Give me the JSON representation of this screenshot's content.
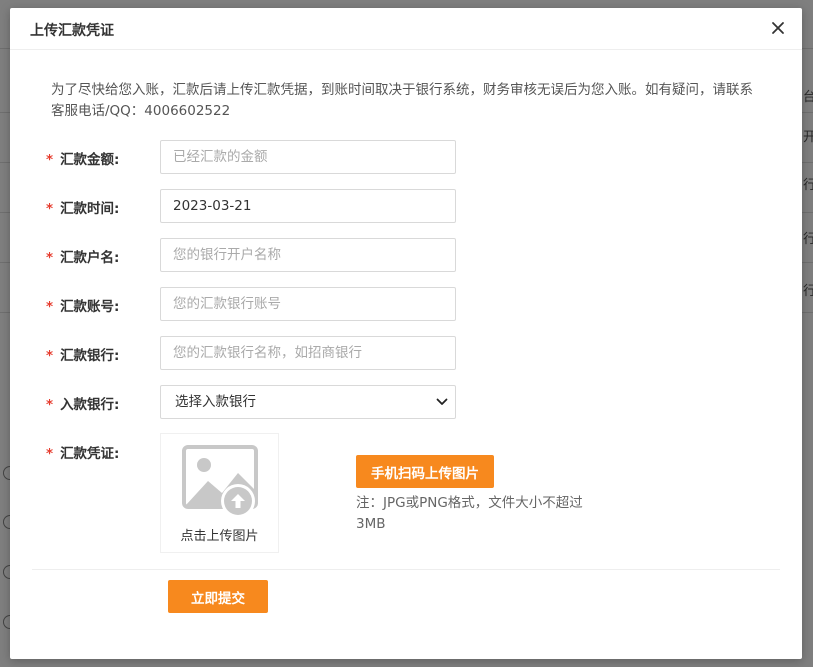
{
  "modal": {
    "title": "上传汇款凭证",
    "notice": "为了尽快给您入账，汇款后请上传汇款凭据，到账时间取决于银行系统，财务审核无误后为您入账。如有疑问，请联系客服电话/QQ：4006602522"
  },
  "form": {
    "required_mark": "*",
    "amount": {
      "label": "汇款金额:",
      "value": "",
      "placeholder": "已经汇款的金额"
    },
    "date": {
      "label": "汇款时间:",
      "value": "2023-03-21",
      "placeholder": ""
    },
    "account_name": {
      "label": "汇款户名:",
      "value": "",
      "placeholder": "您的银行开户名称"
    },
    "account_number": {
      "label": "汇款账号:",
      "value": "",
      "placeholder": "您的汇款银行账号"
    },
    "bank": {
      "label": "汇款银行:",
      "value": "",
      "placeholder": "您的汇款银行名称，如招商银行"
    },
    "receiving_bank": {
      "label": "入款银行:",
      "selected": "选择入款银行"
    },
    "voucher": {
      "label": "汇款凭证:",
      "upload_text": "点击上传图片",
      "upload_icon": "image-upload-icon",
      "scan_button": "手机扫码上传图片",
      "hint": "注：JPG或PNG格式，文件大小不超过3MB"
    },
    "submit": "立即提交"
  },
  "background": {
    "fragments": [
      "台",
      "开",
      "行",
      "行",
      "行"
    ]
  },
  "colors": {
    "accent": "#f7891e",
    "required": "#e63c2e",
    "placeholder": "#aaaaaa"
  }
}
